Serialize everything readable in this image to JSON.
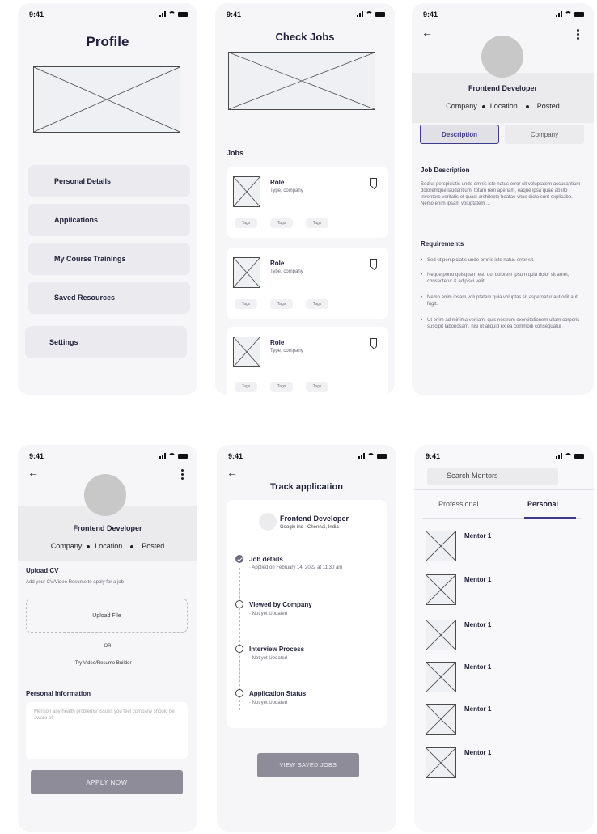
{
  "status_time": "9:41",
  "profile": {
    "title": "Profile",
    "menu": [
      "Personal Details",
      "Applications",
      "My Course Trainings",
      "Saved Resources"
    ],
    "settings": "Settings"
  },
  "check_jobs": {
    "title": "Check Jobs",
    "section": "Jobs",
    "jobs": [
      {
        "role": "Role",
        "sub": "Type, company",
        "tags": [
          "Tags",
          "Tags",
          "Tags"
        ]
      },
      {
        "role": "Role",
        "sub": "Type, company",
        "tags": [
          "Tags",
          "Tags",
          "Tags"
        ]
      },
      {
        "role": "Role",
        "sub": "Type, company",
        "tags": [
          "Tags",
          "Tags",
          "Tags"
        ]
      }
    ]
  },
  "job_detail": {
    "title": "Frontend Developer",
    "meta": [
      "Company",
      "Location",
      "Posted"
    ],
    "tabs": [
      "Description",
      "Company"
    ],
    "desc_heading": "Job Description",
    "desc_text": "Sed ut perspiciatis unde omnis iste natus error sit voluptatem accusantium doloremque laudantium, totam rem aperiam, eaque ipsa quae ab illo inventore veritatis et quasi architecto beatae vitae dicta sunt explicabo. Nemo enim ipsam voluptatem ...",
    "req_heading": "Requirements",
    "requirements": [
      "Sed ut perspiciatis unde omnis iste natus error sit.",
      "Neque porro quisquam est, qui dolorem ipsum quia dolor sit amet, consectetur & adipisci velit.",
      "Nemo enim ipsam voluptatem quia voluptas sit aspernatur aut odit aut fugit.",
      "Ut enim ad minima veniam, quis nostrum exercitationem ullam corporis suscipit laboriosam, nisi ut aliquid ex ea commodi consequatur"
    ]
  },
  "apply": {
    "title": "Frontend Developer",
    "meta": [
      "Company",
      "Location",
      "Posted"
    ],
    "upload_heading": "Upload CV",
    "upload_sub": "Add your CV/Video Resume to apply for a job",
    "upload_button": "Upload File",
    "or": "OR",
    "builder_link": "Try Video/Resume Builder",
    "personal_heading": "Personal Information",
    "personal_placeholder": "Mention any health problems/ issues you feel company should be aware of",
    "apply_button": "APPLY NOW"
  },
  "track": {
    "title": "Track application",
    "job_title": "Frontend Developer",
    "job_sub": "Google inc - Chennai, India",
    "steps": [
      {
        "title": "Job details",
        "sub": "Applied on February 14, 2022 at 11:30 am",
        "done": true
      },
      {
        "title": "Viewed by Company",
        "sub": "Not yet Updated",
        "done": false
      },
      {
        "title": "Interview Process",
        "sub": "Not yet Updated",
        "done": false
      },
      {
        "title": "Application Status",
        "sub": "Not yet Updated",
        "done": false
      }
    ],
    "button": "VIEW SAVED JOBS"
  },
  "mentors": {
    "search_placeholder": "Search Mentors",
    "tabs": [
      "Professional",
      "Personal"
    ],
    "list": [
      "Mentor 1",
      "Mentor 1",
      "Mentor 1",
      "Mentor 1",
      "Mentor 1",
      "Mentor 1"
    ]
  },
  "colors": {
    "accent": "#3d3a8c",
    "button": "#8e8c99",
    "arrow": "#3cb043"
  }
}
